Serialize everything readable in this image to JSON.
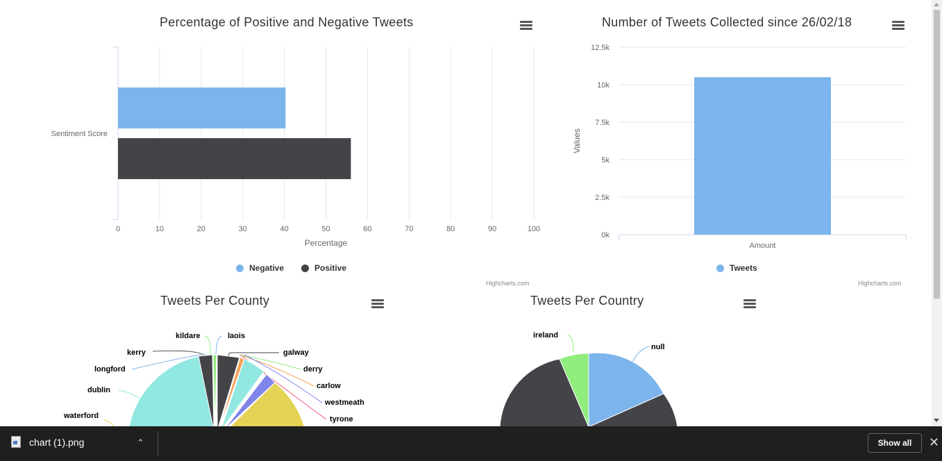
{
  "charts": {
    "sentiment": {
      "title": "Percentage of Positive and Negative Tweets",
      "credit": "Highcharts.com",
      "colors": {
        "Negative": "#7cb5ec",
        "Positive": "#434348"
      }
    },
    "tweets": {
      "title": "Number of Tweets Collected since 26/02/18",
      "credit": "Highcharts.com",
      "color": "#7cb5ec"
    },
    "county": {
      "title": "Tweets Per County"
    },
    "country": {
      "title": "Tweets Per Country"
    }
  },
  "chart_data": [
    {
      "type": "bar",
      "title": "Percentage of Positive and Negative Tweets",
      "categories": [
        "Sentiment Score"
      ],
      "series": [
        {
          "name": "Negative",
          "values": [
            40.3
          ]
        },
        {
          "name": "Positive",
          "values": [
            56
          ]
        }
      ],
      "xlabel": "Percentage",
      "xlim": [
        0,
        100
      ],
      "ticks": [
        "0",
        "10",
        "20",
        "30",
        "40",
        "50",
        "60",
        "70",
        "80",
        "90",
        "100"
      ],
      "legend": "bottom-center",
      "grid": true
    },
    {
      "type": "bar",
      "title": "Number of Tweets Collected since 26/02/18",
      "categories": [
        "Amount"
      ],
      "series": [
        {
          "name": "Tweets",
          "values": [
            10500
          ]
        }
      ],
      "ylabel": "Values",
      "ylim": [
        0,
        12500
      ],
      "ticks": [
        "0k",
        "2.5k",
        "5k",
        "7.5k",
        "10k",
        "12.5k"
      ],
      "legend": "bottom-center",
      "grid": true
    },
    {
      "type": "pie",
      "title": "Tweets Per County",
      "labels": [
        "kildare",
        "laois",
        "kerry",
        "galway",
        "longford",
        "derry",
        "carlow",
        "dublin",
        "westmeath",
        "tyrone",
        "waterford"
      ]
    },
    {
      "type": "pie",
      "title": "Tweets Per Country",
      "labels": [
        "ireland",
        "null"
      ]
    }
  ],
  "download_bar": {
    "file_name": "chart (1).png",
    "show_all": "Show all"
  }
}
